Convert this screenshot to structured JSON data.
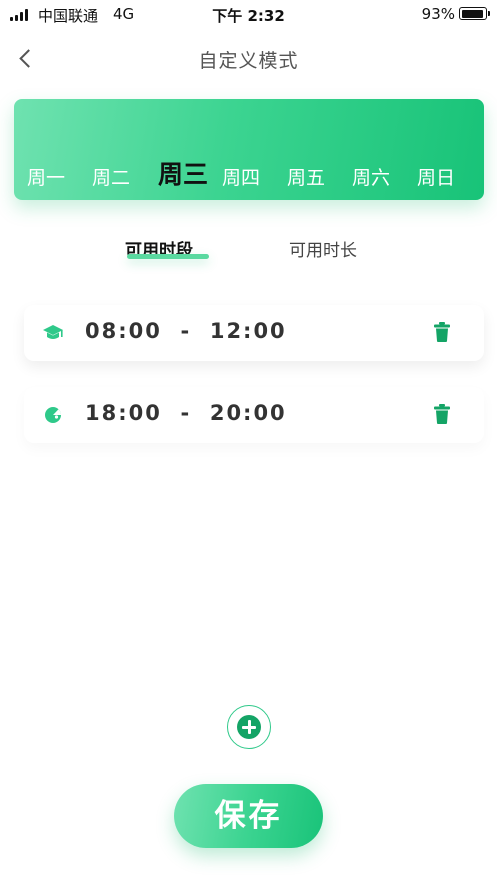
{
  "status_bar": {
    "carrier": "中国联通",
    "network": "4G",
    "time": "下午 2:32",
    "battery": "93%"
  },
  "nav": {
    "title": "自定义模式"
  },
  "week": {
    "days": [
      "周一",
      "周二",
      "周三",
      "周四",
      "周五",
      "周六",
      "周日"
    ],
    "selected": "周三"
  },
  "tabs": [
    {
      "label": "可用时段",
      "active": true
    },
    {
      "label": "可用时长",
      "active": false
    }
  ],
  "time_slots": [
    {
      "icon": "graduation-cap-icon",
      "start": "08:00",
      "separator": "-",
      "end": "12:00"
    },
    {
      "icon": "pie-chart-icon",
      "start": "18:00",
      "separator": "-",
      "end": "20:00"
    }
  ],
  "actions": {
    "save_label": "保存"
  },
  "colors": {
    "brand_green": "#2fc98a",
    "icon_green": "#14a466",
    "highlight_yellow": "#f0f05a"
  }
}
